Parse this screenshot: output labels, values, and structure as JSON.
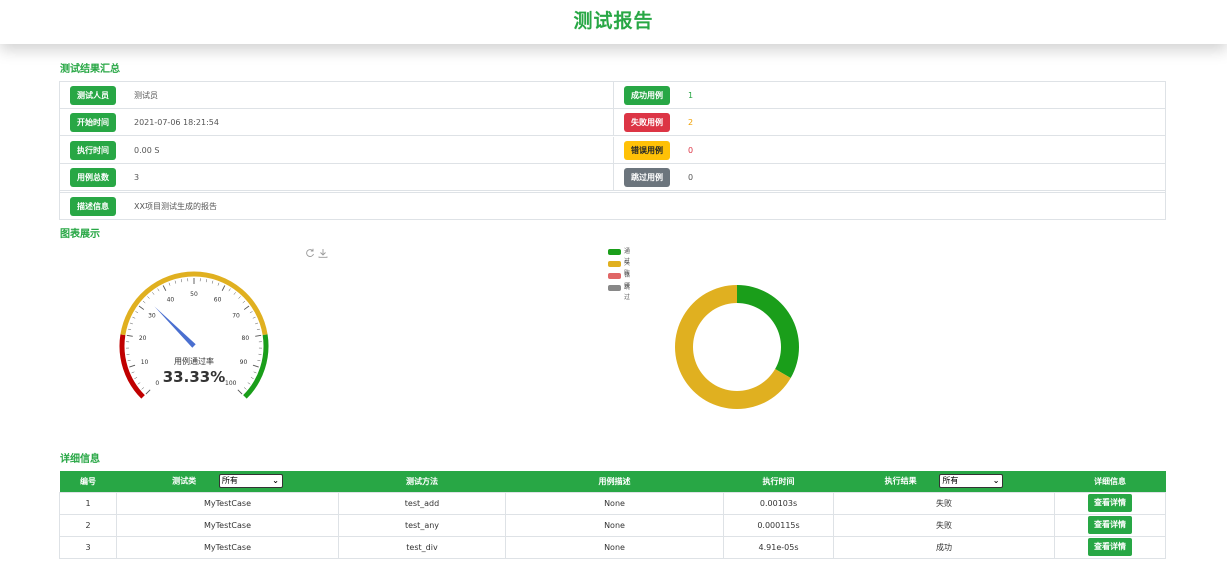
{
  "header": {
    "title": "测试报告"
  },
  "summary": {
    "title": "测试结果汇总",
    "tester_label": "测试人员",
    "tester_value": "测试员",
    "start_label": "开始时间",
    "start_value": "2021-07-06 18:21:54",
    "duration_label": "执行时间",
    "duration_value": "0.00 S",
    "total_label": "用例总数",
    "total_value": "3",
    "desc_label": "描述信息",
    "desc_value": "XX项目测试生成的报告",
    "success_label": "成功用例",
    "success_value": "1",
    "fail_label": "失败用例",
    "fail_value": "2",
    "error_label": "错误用例",
    "error_value": "0",
    "skip_label": "跳过用例",
    "skip_value": "0"
  },
  "charts": {
    "title": "图表展示",
    "toolbox": {
      "refresh_icon": "refresh-icon",
      "download_icon": "download-icon"
    },
    "gauge": {
      "label": "用例通过率",
      "value_text": "33.33%",
      "value": 33.33,
      "min": 0,
      "max": 100,
      "ticks": [
        "0",
        "10",
        "20",
        "30",
        "40",
        "50",
        "60",
        "70",
        "80",
        "90",
        "100"
      ],
      "bands": [
        {
          "to": 0.2,
          "color": "#c00000"
        },
        {
          "to": 0.8,
          "color": "#e0b020"
        },
        {
          "to": 1.0,
          "color": "#1a9e1a"
        }
      ],
      "needle_color": "#4a6fd0"
    },
    "donut_legend": [
      {
        "label": "通过",
        "color": "#1a9e1a"
      },
      {
        "label": "失败",
        "color": "#e0b020"
      },
      {
        "label": "错误",
        "color": "#e06666"
      },
      {
        "label": "跳过",
        "color": "#888888"
      }
    ]
  },
  "chart_data": {
    "type": "pie",
    "categories": [
      "通过",
      "失败",
      "错误",
      "跳过"
    ],
    "values": [
      1,
      2,
      0,
      0
    ]
  },
  "detail": {
    "title": "详细信息",
    "headers": [
      "编号",
      "测试类",
      "测试方法",
      "用例描述",
      "执行时间",
      "执行结果",
      "详细信息"
    ],
    "class_filter": "所有",
    "result_filter": "所有",
    "rows": [
      {
        "no": "1",
        "cls": "MyTestCase",
        "method": "test_add",
        "desc": "None",
        "time": "0.00103s",
        "result": "失败",
        "action": "查看详情"
      },
      {
        "no": "2",
        "cls": "MyTestCase",
        "method": "test_any",
        "desc": "None",
        "time": "0.000115s",
        "result": "失败",
        "action": "查看详情"
      },
      {
        "no": "3",
        "cls": "MyTestCase",
        "method": "test_div",
        "desc": "None",
        "time": "4.91e-05s",
        "result": "成功",
        "action": "查看详情"
      }
    ]
  }
}
